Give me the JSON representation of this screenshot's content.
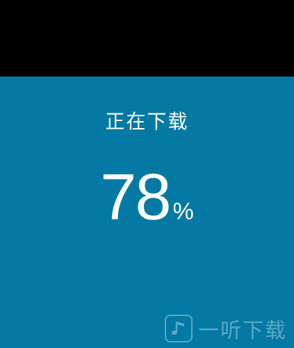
{
  "download": {
    "status_label": "正在下载",
    "progress_value": "78",
    "progress_unit": "%",
    "progress_fraction": 0.78
  },
  "watermark": {
    "icon": "music-note-app-icon",
    "text": "一听下载"
  },
  "colors": {
    "background": "#000000",
    "progress_fill": "#0379a3",
    "text": "#ffffff"
  }
}
